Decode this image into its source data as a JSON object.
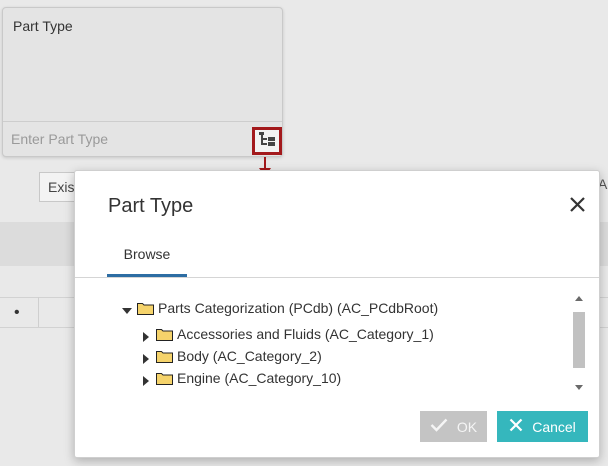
{
  "background": {
    "select_text": "Exis",
    "bullet": "•",
    "edge_text": "Al"
  },
  "part_type_card": {
    "label": "Part Type",
    "input_placeholder": "Enter Part Type",
    "tree_button_icon": "tree-view-icon",
    "highlight_color": "#a3191c"
  },
  "modal": {
    "title": "Part Type",
    "close_icon": "close-icon",
    "tabs": [
      {
        "label": "Browse",
        "active": true
      }
    ],
    "tree": {
      "root": {
        "label": "Parts Categorization (PCdb) (AC_PCdbRoot)",
        "expanded": true,
        "children": [
          {
            "label": "Accessories and Fluids (AC_Category_1)",
            "expanded": false
          },
          {
            "label": "Body (AC_Category_2)",
            "expanded": false
          },
          {
            "label": "Engine (AC_Category_10)",
            "expanded": false
          }
        ]
      }
    },
    "buttons": {
      "ok_label": "OK",
      "cancel_label": "Cancel"
    },
    "colors": {
      "tab_underline": "#2d6da3",
      "ok_disabled": "#c4c4c4",
      "cancel": "#35b7bd",
      "folder": "#f5d36b"
    }
  }
}
